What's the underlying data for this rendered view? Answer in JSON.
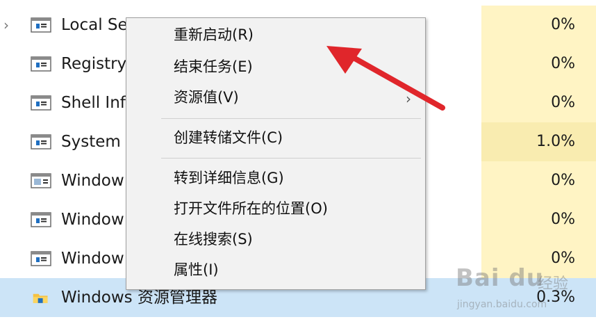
{
  "processes": [
    {
      "name": "Local Se",
      "cpu": "0%",
      "icon": "service-window-icon",
      "expandable": true
    },
    {
      "name": "Registry",
      "cpu": "0%",
      "icon": "service-window-icon",
      "expandable": false
    },
    {
      "name": "Shell Inf",
      "cpu": "0%",
      "icon": "service-window-icon",
      "expandable": false
    },
    {
      "name": "System",
      "cpu": "1.0%",
      "icon": "service-window-icon",
      "expandable": false
    },
    {
      "name": "Window",
      "cpu": "0%",
      "icon": "app-window-icon",
      "expandable": false
    },
    {
      "name": "Window",
      "cpu": "0%",
      "icon": "service-window-icon",
      "expandable": false
    },
    {
      "name": "Window",
      "cpu": "0%",
      "icon": "service-window-icon",
      "expandable": false
    },
    {
      "name": "Windows 资源管理器",
      "cpu": "0.3%",
      "icon": "folder-icon",
      "expandable": false
    }
  ],
  "context_menu": {
    "items": [
      {
        "label": "重新启动(R)"
      },
      {
        "label": "结束任务(E)"
      },
      {
        "label": "资源值(V)",
        "has_submenu": true
      },
      {
        "label": "创建转储文件(C)"
      },
      {
        "label": "转到详细信息(G)"
      },
      {
        "label": "打开文件所在的位置(O)"
      },
      {
        "label": "在线搜索(S)"
      },
      {
        "label": "属性(I)"
      }
    ]
  },
  "annotation": {
    "color": "#e0262b"
  },
  "watermark": {
    "logo": "Bai du",
    "cn": "经验",
    "url": "jingyan.baidu.com"
  }
}
